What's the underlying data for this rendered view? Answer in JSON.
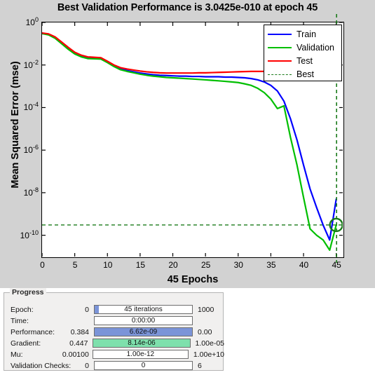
{
  "chart_data": {
    "type": "line",
    "title": "Best Validation Performance is 3.0425e-010 at epoch 45",
    "xlabel": "45 Epochs",
    "ylabel": "Mean Squared Error  (mse)",
    "yscale": "log",
    "ylim": [
      1e-11,
      1
    ],
    "xlim": [
      0,
      46
    ],
    "grid": false,
    "legend_position": "top-right",
    "xticks": [
      "0",
      "5",
      "10",
      "15",
      "20",
      "25",
      "30",
      "35",
      "40",
      "45"
    ],
    "xtick_values": [
      0,
      5,
      10,
      15,
      20,
      25,
      30,
      35,
      40,
      45
    ],
    "yticks": [
      "10^0",
      "10^-2",
      "10^-4",
      "10^-6",
      "10^-8",
      "10^-10"
    ],
    "ytick_values": [
      1,
      0.01,
      0.0001,
      1e-06,
      1e-08,
      1e-10
    ],
    "best_epoch": 45,
    "best_value": 3.0425e-10,
    "best_marker": "circle",
    "x": [
      0,
      1,
      2,
      3,
      4,
      5,
      6,
      7,
      8,
      9,
      10,
      11,
      12,
      13,
      14,
      15,
      16,
      17,
      18,
      19,
      20,
      21,
      22,
      23,
      24,
      25,
      26,
      27,
      28,
      29,
      30,
      31,
      32,
      33,
      34,
      35,
      36,
      37,
      38,
      39,
      40,
      41,
      42,
      43,
      44,
      45
    ],
    "series": [
      {
        "name": "Train",
        "color": "#0000ff",
        "values": [
          0.3,
          0.27,
          0.19,
          0.11,
          0.06,
          0.036,
          0.026,
          0.022,
          0.021,
          0.02,
          0.0135,
          0.009,
          0.0065,
          0.0055,
          0.0048,
          0.0042,
          0.0038,
          0.0035,
          0.0033,
          0.0032,
          0.0031,
          0.003,
          0.003,
          0.0029,
          0.0029,
          0.0028,
          0.0028,
          0.0028,
          0.0027,
          0.0027,
          0.0026,
          0.0025,
          0.0023,
          0.002,
          0.0016,
          0.0011,
          0.0006,
          0.0002,
          3e-05,
          3e-06,
          2e-07,
          1.5e-08,
          2e-09,
          3e-10,
          6e-11,
          5e-09
        ]
      },
      {
        "name": "Validation",
        "color": "#00bf00",
        "values": [
          0.3,
          0.26,
          0.18,
          0.1,
          0.055,
          0.033,
          0.024,
          0.02,
          0.0195,
          0.019,
          0.013,
          0.0085,
          0.006,
          0.005,
          0.0043,
          0.0037,
          0.0033,
          0.003,
          0.0028,
          0.0026,
          0.0025,
          0.0024,
          0.0023,
          0.0022,
          0.0021,
          0.002,
          0.0019,
          0.0018,
          0.0017,
          0.0016,
          0.0015,
          0.0013,
          0.0011,
          0.0008,
          0.0005,
          0.00025,
          9e-05,
          0.00012,
          4e-06,
          2e-07,
          6e-09,
          2e-10,
          1e-10,
          6e-11,
          2e-11,
          3.0425e-10
        ]
      },
      {
        "name": "Test",
        "color": "#ff0000",
        "values": [
          0.32,
          0.29,
          0.21,
          0.12,
          0.068,
          0.04,
          0.029,
          0.024,
          0.023,
          0.022,
          0.015,
          0.01,
          0.0075,
          0.0065,
          0.0058,
          0.0052,
          0.0048,
          0.0045,
          0.0043,
          0.0042,
          0.0042,
          0.0042,
          0.0042,
          0.0042,
          0.0043,
          0.0043,
          0.0044,
          0.0045,
          0.0046,
          0.0047,
          0.0048,
          0.0049,
          0.005,
          0.005,
          0.005,
          0.005,
          0.005,
          0.005,
          0.005,
          0.005,
          0.005,
          0.005,
          0.005,
          0.005,
          0.005,
          0.005
        ]
      }
    ],
    "legend": [
      {
        "label": "Train",
        "color": "#0000ff",
        "style": "solid"
      },
      {
        "label": "Validation",
        "color": "#00bf00",
        "style": "solid"
      },
      {
        "label": "Test",
        "color": "#ff0000",
        "style": "solid"
      },
      {
        "label": "Best",
        "color": "#1a7a1a",
        "style": "dashed"
      }
    ]
  },
  "progress": {
    "group_title": "Progress",
    "rows": [
      {
        "name": "Epoch:",
        "left": "0",
        "bar_text": "45 iterations",
        "right": "1000",
        "fill_pct": 4.5,
        "fill_color": "#7b94d8"
      },
      {
        "name": "Time:",
        "left": "",
        "bar_text": "0:00:00",
        "right": "",
        "fill_pct": 0,
        "fill_color": "#7b94d8"
      },
      {
        "name": "Performance:",
        "left": "0.384",
        "bar_text": "6.62e-09",
        "right": "0.00",
        "fill_pct": 100,
        "fill_color": "#7b94d8"
      },
      {
        "name": "Gradient:",
        "left": "0.447",
        "bar_text": "8.14e-06",
        "right": "1.00e-05",
        "fill_pct": 100,
        "fill_color": "#7ee0ac"
      },
      {
        "name": "Mu:",
        "left": "0.00100",
        "bar_text": "1.00e-12",
        "right": "1.00e+10",
        "fill_pct": 0,
        "fill_color": "#7b94d8"
      },
      {
        "name": "Validation Checks:",
        "left": "0",
        "bar_text": "0",
        "right": "6",
        "fill_pct": 0,
        "fill_color": "#7b94d8"
      }
    ]
  },
  "colors": {
    "chart_background": "#d2d2d2",
    "plot_background": "#ffffff",
    "train": "#0000ff",
    "validation": "#00bf00",
    "test": "#ff0000",
    "best": "#1a7a1a",
    "panel_background": "#ffffff",
    "group_background": "#f1f0ef"
  }
}
